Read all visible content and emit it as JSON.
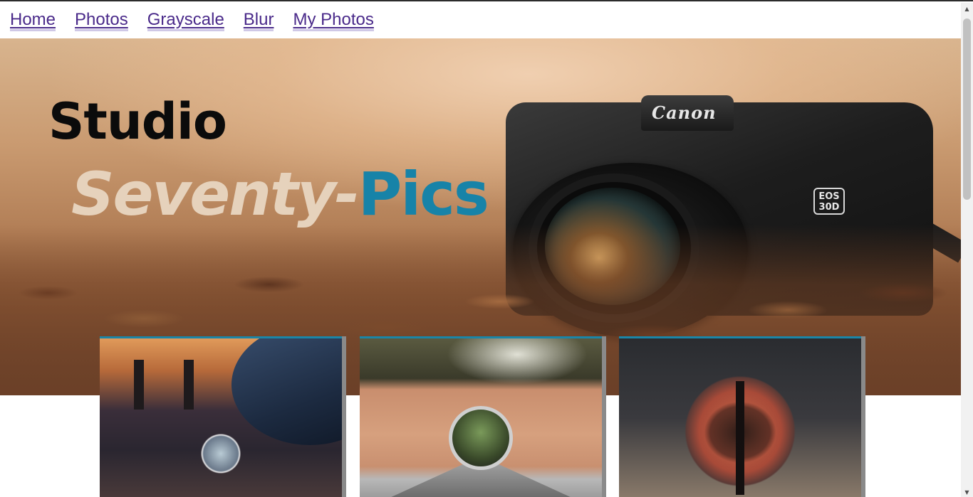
{
  "nav": {
    "items": [
      {
        "label": "Home"
      },
      {
        "label": "Photos"
      },
      {
        "label": "Grayscale"
      },
      {
        "label": "Blur"
      },
      {
        "label": "My Photos"
      }
    ]
  },
  "hero": {
    "title_line1": "Studio",
    "title_part1": "Seventy-",
    "title_part2": "Pics",
    "camera_brand": "Canon",
    "camera_model": "EOS 30D"
  },
  "gallery": {
    "cards": [
      {
        "name": "crystal-ball-bridge-photo"
      },
      {
        "name": "wristwatch-road-photo"
      },
      {
        "name": "tree-moon-photo"
      }
    ]
  },
  "colors": {
    "accent": "#1783a8",
    "nav_link": "#4a2a8a",
    "title_light": "#e6d2bc"
  },
  "icons": {
    "scroll_up": "triangle-up-icon",
    "scroll_down": "triangle-down-icon"
  }
}
